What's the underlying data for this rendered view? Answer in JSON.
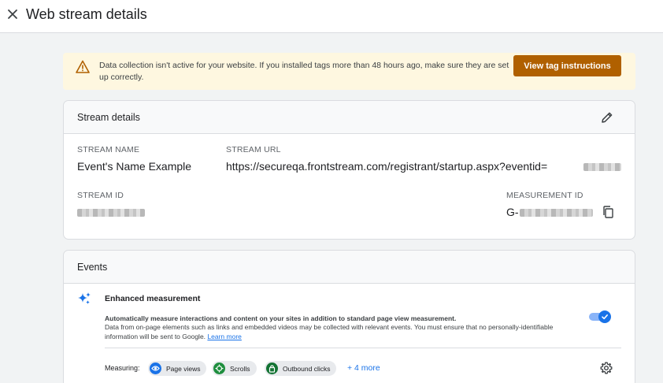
{
  "header": {
    "title": "Web stream details",
    "close_icon": "close-icon"
  },
  "banner": {
    "icon": "warning-icon",
    "message": "Data collection isn't active for your website. If you installed tags more than 48 hours ago, make sure they are set up correctly.",
    "button_label": "View tag instructions",
    "button_color": "#b06000",
    "background": "#fef7e0"
  },
  "stream_details": {
    "title": "Stream details",
    "edit_icon": "pencil-icon",
    "stream_name_label": "STREAM NAME",
    "stream_name": "Event's Name Example",
    "stream_url_label": "STREAM URL",
    "stream_url": "https://secureqa.frontstream.com/registrant/startup.aspx?eventid=",
    "stream_id_label": "STREAM ID",
    "measurement_id_label": "MEASUREMENT ID",
    "measurement_id_prefix": "G-",
    "copy_icon": "copy-icon"
  },
  "events": {
    "title": "Events",
    "enhanced": {
      "icon": "sparkle-icon",
      "title": "Enhanced measurement",
      "description_bold": "Automatically measure interactions and content on your sites in addition to standard page view measurement.",
      "description": "Data from on-page elements such as links and embedded videos may be collected with relevant events. You must ensure that no personally-identifiable information will be sent to Google.",
      "learn_more": "Learn more",
      "toggle_on": true,
      "accent": "#1a73e8"
    },
    "measuring_label": "Measuring:",
    "chips": [
      {
        "label": "Page views",
        "icon": "eye-icon",
        "color": "#1a73e8"
      },
      {
        "label": "Scrolls",
        "icon": "crosshair-icon",
        "color": "#1e8e3e"
      },
      {
        "label": "Outbound clicks",
        "icon": "lock-icon",
        "color": "#137333"
      }
    ],
    "more_link": "+ 4 more",
    "settings_icon": "gear-icon"
  }
}
